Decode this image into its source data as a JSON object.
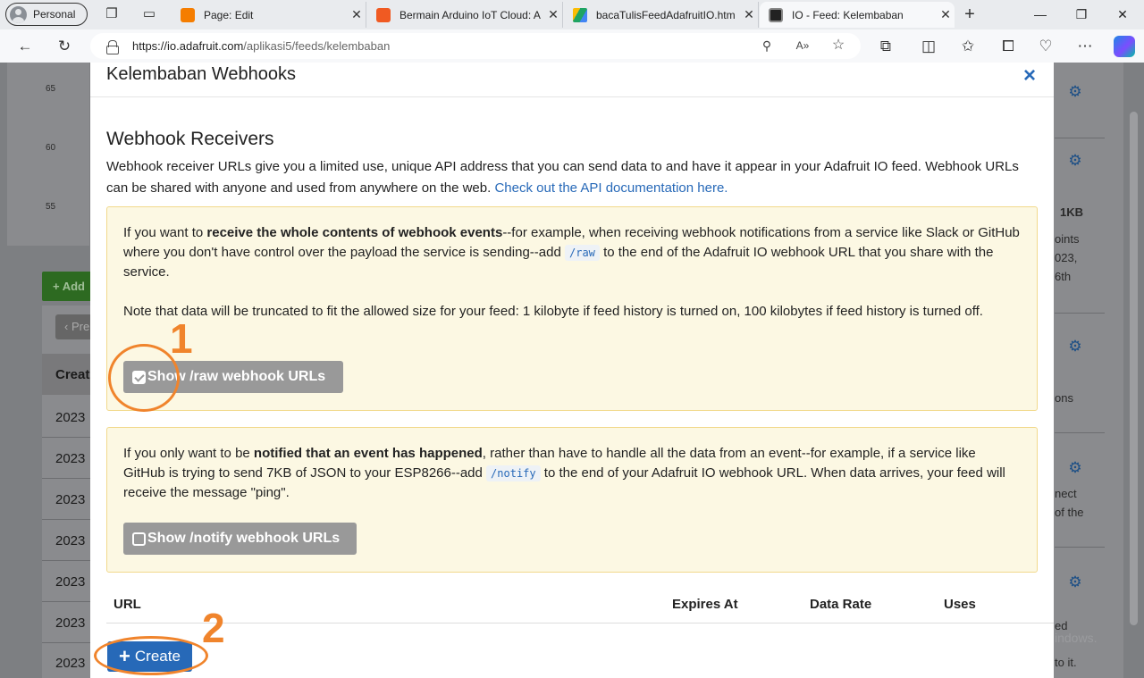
{
  "browser": {
    "profile_label": "Personal",
    "tabs": [
      {
        "title": "Page: Edit",
        "favicon": "blogger-icon",
        "color": "#f57d00"
      },
      {
        "title": "Bermain Arduino IoT Cloud: A",
        "favicon": "blogger-icon",
        "color": "#f05a22"
      },
      {
        "title": "bacaTulisFeedAdafruitIO.htm",
        "favicon": "google-drive-icon",
        "color": "#1fa463"
      },
      {
        "title": "IO - Feed: Kelembaban",
        "favicon": "adafruit-icon",
        "color": "#222222"
      }
    ],
    "url_host": "https://io.adafruit.com",
    "url_path": "/aplikasi5/feeds/kelembaban"
  },
  "background": {
    "axis_ticks": [
      "65",
      "60",
      "55"
    ],
    "add_button": "+ Add",
    "prev_button": "Pre",
    "column_head": "Creat",
    "years": [
      "2023",
      "2023",
      "2023",
      "2023",
      "2023",
      "2023",
      "2023"
    ],
    "right_texts": [
      "1KB",
      "oints",
      "023,",
      "6th",
      "ons",
      "nect",
      "of the",
      "ed",
      "to it."
    ],
    "watermark": "indows."
  },
  "modal": {
    "title": "Kelembaban Webhooks",
    "close_label": "×",
    "section_title": "Webhook Receivers",
    "intro_text": "Webhook receiver URLs give you a limited use, unique API address that you can send data to and have it appear in your Adafruit IO feed. Webhook URLs can be shared with anyone and used from anywhere on the web.",
    "intro_link": "Check out the API documentation here.",
    "raw_box": {
      "p1_before": "If you want to ",
      "p1_bold": "receive the whole contents of webhook events",
      "p1_middle": "--for example, when receiving webhook notifications from a service like Slack or GitHub where you don't have control over the payload the service is sending--add ",
      "p1_code": "/raw",
      "p1_after": " to the end of the Adafruit IO webhook URL that you share with the service.",
      "p2": "Note that data will be truncated to fit the allowed size for your feed: 1 kilobyte if feed history is turned on, 100 kilobytes if feed history is turned off.",
      "button_label": "Show /raw webhook URLs",
      "checked": true
    },
    "notify_box": {
      "p1_before": "If you only want to be ",
      "p1_bold": "notified that an event has happened",
      "p1_middle": ", rather than have to handle all the data from an event--for example, if a service like GitHub is trying to send 7KB of JSON to your ESP8266--add ",
      "p1_code": "/notify",
      "p1_after": " to the end of your Adafruit IO webhook URL. When data arrives, your feed will receive the message \"ping\".",
      "button_label": "Show /notify webhook URLs",
      "checked": false
    },
    "table_headers": [
      "URL",
      "Expires At",
      "Data Rate",
      "Uses"
    ],
    "create_label": "Create"
  },
  "annotations": {
    "step1": "1",
    "step2": "2",
    "color": "#f0842c"
  },
  "colors": {
    "link": "#2769b8",
    "callout_bg": "#fcf8e3",
    "button_grey": "#999999"
  }
}
